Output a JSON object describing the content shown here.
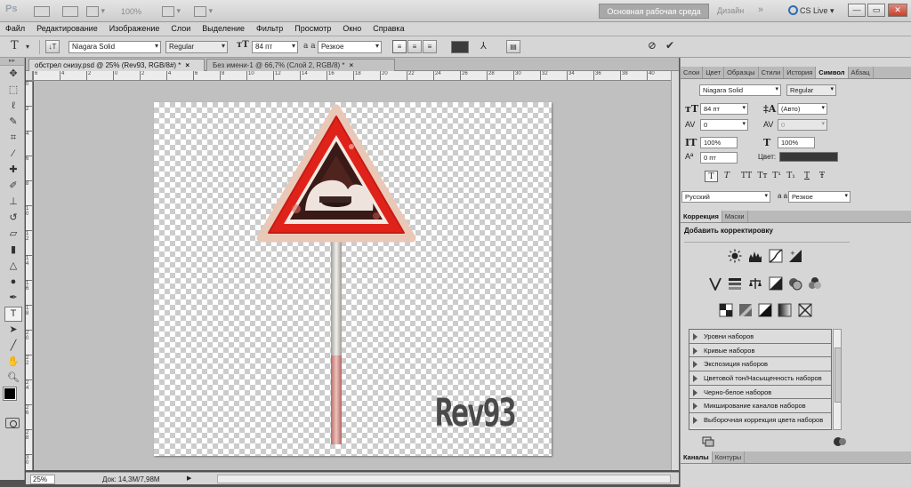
{
  "appbar": {
    "logo": "Ps",
    "zoom": "100%",
    "workspace_active": "Основная рабочая среда",
    "workspace_other": "Дизайн",
    "more": "»",
    "cslive": "CS Live",
    "win_min": "—",
    "win_max": "▭",
    "win_close": "✕"
  },
  "menu": [
    "Файл",
    "Редактирование",
    "Изображение",
    "Слои",
    "Выделение",
    "Фильтр",
    "Просмотр",
    "Окно",
    "Справка"
  ],
  "options": {
    "font_family": "Niagara Solid",
    "font_style": "Regular",
    "font_size": "84 пт",
    "antialias": "Резкое",
    "aa_label": "a a",
    "color": "#3b3b3b"
  },
  "tabs": [
    {
      "label": "обстрел снизу.psd @ 25% (Rev93, RGB/8#) *",
      "close": "×"
    },
    {
      "label": "Без имени-1 @ 66,7% (Слой 2, RGB/8) *",
      "close": "×"
    }
  ],
  "ruler_h": [
    "6",
    "4",
    "2",
    "0",
    "2",
    "4",
    "6",
    "8",
    "10",
    "12",
    "14",
    "16",
    "18",
    "20",
    "22",
    "24",
    "26",
    "28",
    "30",
    "32",
    "34",
    "36",
    "38",
    "40",
    "42"
  ],
  "ruler_v": [
    "0",
    "2",
    "4",
    "6",
    "8",
    "1\n0",
    "1\n2",
    "1\n4",
    "1\n6",
    "1\n8",
    "2\n0",
    "2\n2",
    "2\n4",
    "2\n6",
    "2\n8",
    "3\n0"
  ],
  "canvas": {
    "watermark": "Rev93"
  },
  "status": {
    "zoom": "25%",
    "doc": "Док: 14,3M/7,98M"
  },
  "panel_top_tabs": [
    "Слои",
    "Цвет",
    "Образцы",
    "Стили",
    "История",
    "Символ",
    "Абзац"
  ],
  "character": {
    "font_family": "Niagara Solid",
    "font_style": "Regular",
    "size": "84 пт",
    "leading": "(Авто)",
    "kerning": "0",
    "tracking": "0",
    "vscale": "100%",
    "hscale": "100%",
    "baseline": "0 пт",
    "color_label": "Цвет:",
    "language": "Русский",
    "antialias": "Резкое",
    "aa_label": "a a",
    "style_buttons": [
      "T",
      "T",
      "TT",
      "Tт",
      "T¹",
      "T₁",
      "T",
      "Ŧ"
    ]
  },
  "adjust_tabs": [
    "Коррекция",
    "Маски"
  ],
  "adjust_title": "Добавить корректировку",
  "presets": [
    "Уровни наборов",
    "Кривые наборов",
    "Экспозиция наборов",
    "Цветовой тон/Насыщенность наборов",
    "Черно-белое наборов",
    "Микширование каналов наборов",
    "Выборочная коррекция цвета наборов"
  ],
  "bottom_tabs": [
    "Каналы",
    "Контуры"
  ]
}
